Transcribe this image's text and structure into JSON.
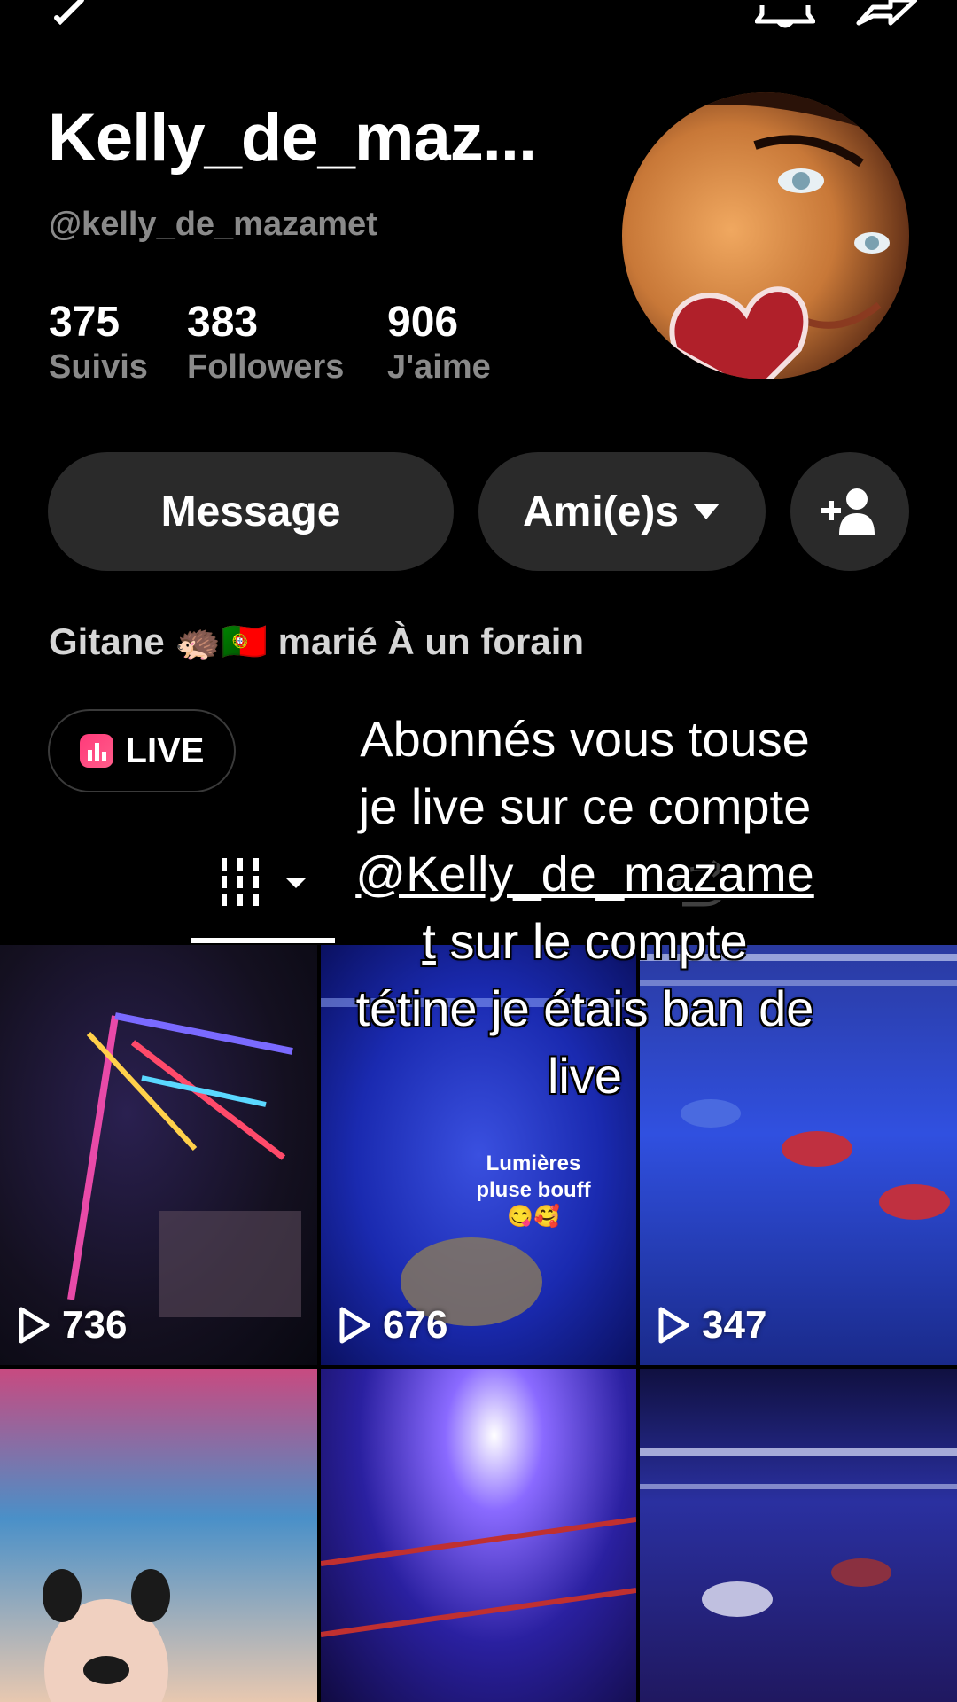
{
  "header": {
    "display_name": "Kelly_de_maz...",
    "handle": "@kelly_de_mazamet"
  },
  "stats": [
    {
      "value": "375",
      "label": "Suivis"
    },
    {
      "value": "383",
      "label": "Followers"
    },
    {
      "value": "906",
      "label": "J'aime"
    }
  ],
  "actions": {
    "message_label": "Message",
    "friends_label": "Ami(e)s"
  },
  "bio": "Gitane 🦔🇵🇹 marié À un forain",
  "live_label": "LIVE",
  "overlay": {
    "line1": "Abonnés vous touse",
    "line2": "je live sur ce compte",
    "mention": "@Kelly_de_mazame",
    "mention_tail": "t",
    "line4_rest": " sur le compte",
    "line5": "tétine je étais ban de",
    "line6": "live"
  },
  "videos": [
    {
      "views": "736",
      "caption": ""
    },
    {
      "views": "676",
      "caption": "Lumières pluse bouff 😋🥰"
    },
    {
      "views": "347",
      "caption": ""
    },
    {
      "views": "",
      "caption": ""
    },
    {
      "views": "",
      "caption": ""
    },
    {
      "views": "",
      "caption": ""
    }
  ],
  "icons": {
    "back": "chevron-left-icon",
    "bell": "bell-icon",
    "share": "share-icon",
    "add_friend": "add-user-icon",
    "dropdown": "caret-down-icon",
    "play": "play-icon",
    "live": "live-bars-icon",
    "grid_tab": "grid-icon",
    "repost_tab": "repost-icon"
  },
  "colors": {
    "background": "#000000",
    "pill": "#2a2a2a",
    "muted_text": "#8a8a8a",
    "live_accent": "#ff3a7a"
  }
}
